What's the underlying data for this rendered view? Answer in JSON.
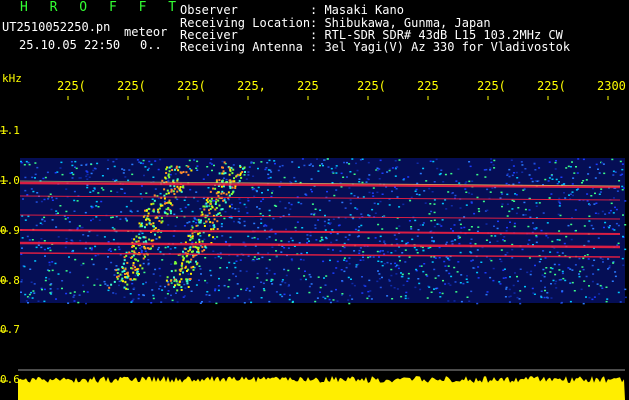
{
  "header": {
    "program": "H R O F F T",
    "file_name": "UT2510052250.pn",
    "mode": "meteor",
    "datetime": "25.10.05 22:50",
    "count": "0.."
  },
  "station": [
    {
      "label": "Observer",
      "value": ": Masaki Kano"
    },
    {
      "label": "Receiving Location",
      "value": ": Shibukawa, Gunma, Japan"
    },
    {
      "label": "Receiver",
      "value": ": RTL-SDR SDR# 43dB L15 103.2MHz CW"
    },
    {
      "label": "Receiving Antenna",
      "value": ": 3el Yagi(V) Az 330 for Vladivostok"
    }
  ],
  "axis": {
    "unit": "kHz",
    "time_ticks": [
      "225(",
      "225(",
      "225(",
      "225,",
      "225",
      "225(",
      "225",
      "225(",
      "225(",
      "2300"
    ],
    "freq_ticks": [
      "1.1",
      "1.0",
      "0.9",
      "0.8",
      "0.7",
      "0.6"
    ]
  },
  "colors": {
    "background": "#000000",
    "title_green": "#33ff33",
    "axis_yellow": "#ffff00",
    "band_red": "#ff2040",
    "noise_blue": "#1a3cff",
    "level_yellow": "#ffee00"
  }
}
